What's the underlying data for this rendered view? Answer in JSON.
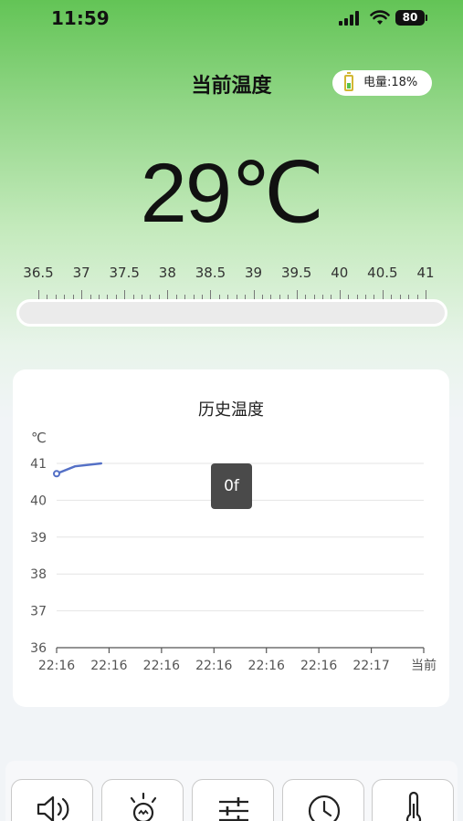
{
  "status_bar": {
    "time": "11:59",
    "battery": "80"
  },
  "header": {
    "title": "当前温度",
    "power_label": "电量:18%"
  },
  "current": {
    "temperature": "29℃"
  },
  "scale": {
    "labels": [
      "36.5",
      "37",
      "37.5",
      "38",
      "38.5",
      "39",
      "39.5",
      "40",
      "40.5",
      "41"
    ],
    "progress": 0
  },
  "history": {
    "title": "历史温度",
    "unit": "℃",
    "tooltip": "0f"
  },
  "chart_data": {
    "type": "line",
    "title": "历史温度",
    "ylabel": "℃",
    "ylim": [
      36,
      41
    ],
    "yticks": [
      "36",
      "37",
      "38",
      "39",
      "40",
      "41"
    ],
    "categories": [
      "22:16",
      "22:16",
      "22:16",
      "22:16",
      "22:16",
      "22:16",
      "22:17",
      "当前"
    ],
    "series": [
      {
        "points": [
          {
            "x": 0,
            "y": 40.72
          },
          {
            "x": 0.35,
            "y": 40.92
          },
          {
            "x": 0.85,
            "y": 41.0
          }
        ],
        "color": "#5470c6"
      }
    ],
    "grid": true
  },
  "toolbar": {
    "buttons": [
      {
        "icon": "speaker-icon"
      },
      {
        "icon": "bulb-icon"
      },
      {
        "icon": "sliders-icon"
      },
      {
        "icon": "clock-icon"
      },
      {
        "icon": "thermometer-icon"
      }
    ]
  }
}
